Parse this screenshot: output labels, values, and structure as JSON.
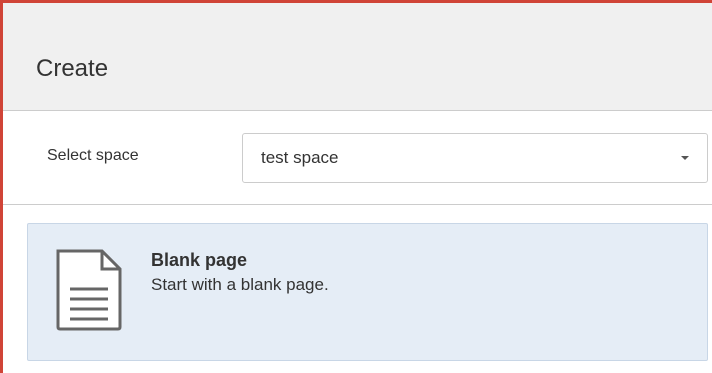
{
  "dialog": {
    "title": "Create"
  },
  "space": {
    "label": "Select space",
    "selected": "test space"
  },
  "templates": [
    {
      "name": "Blank page",
      "description": "Start with a blank page.",
      "icon": "document-icon"
    }
  ],
  "colors": {
    "frame": "#d04437",
    "header_bg": "#f0f0f0",
    "selected_item_bg": "#e5edf6"
  }
}
